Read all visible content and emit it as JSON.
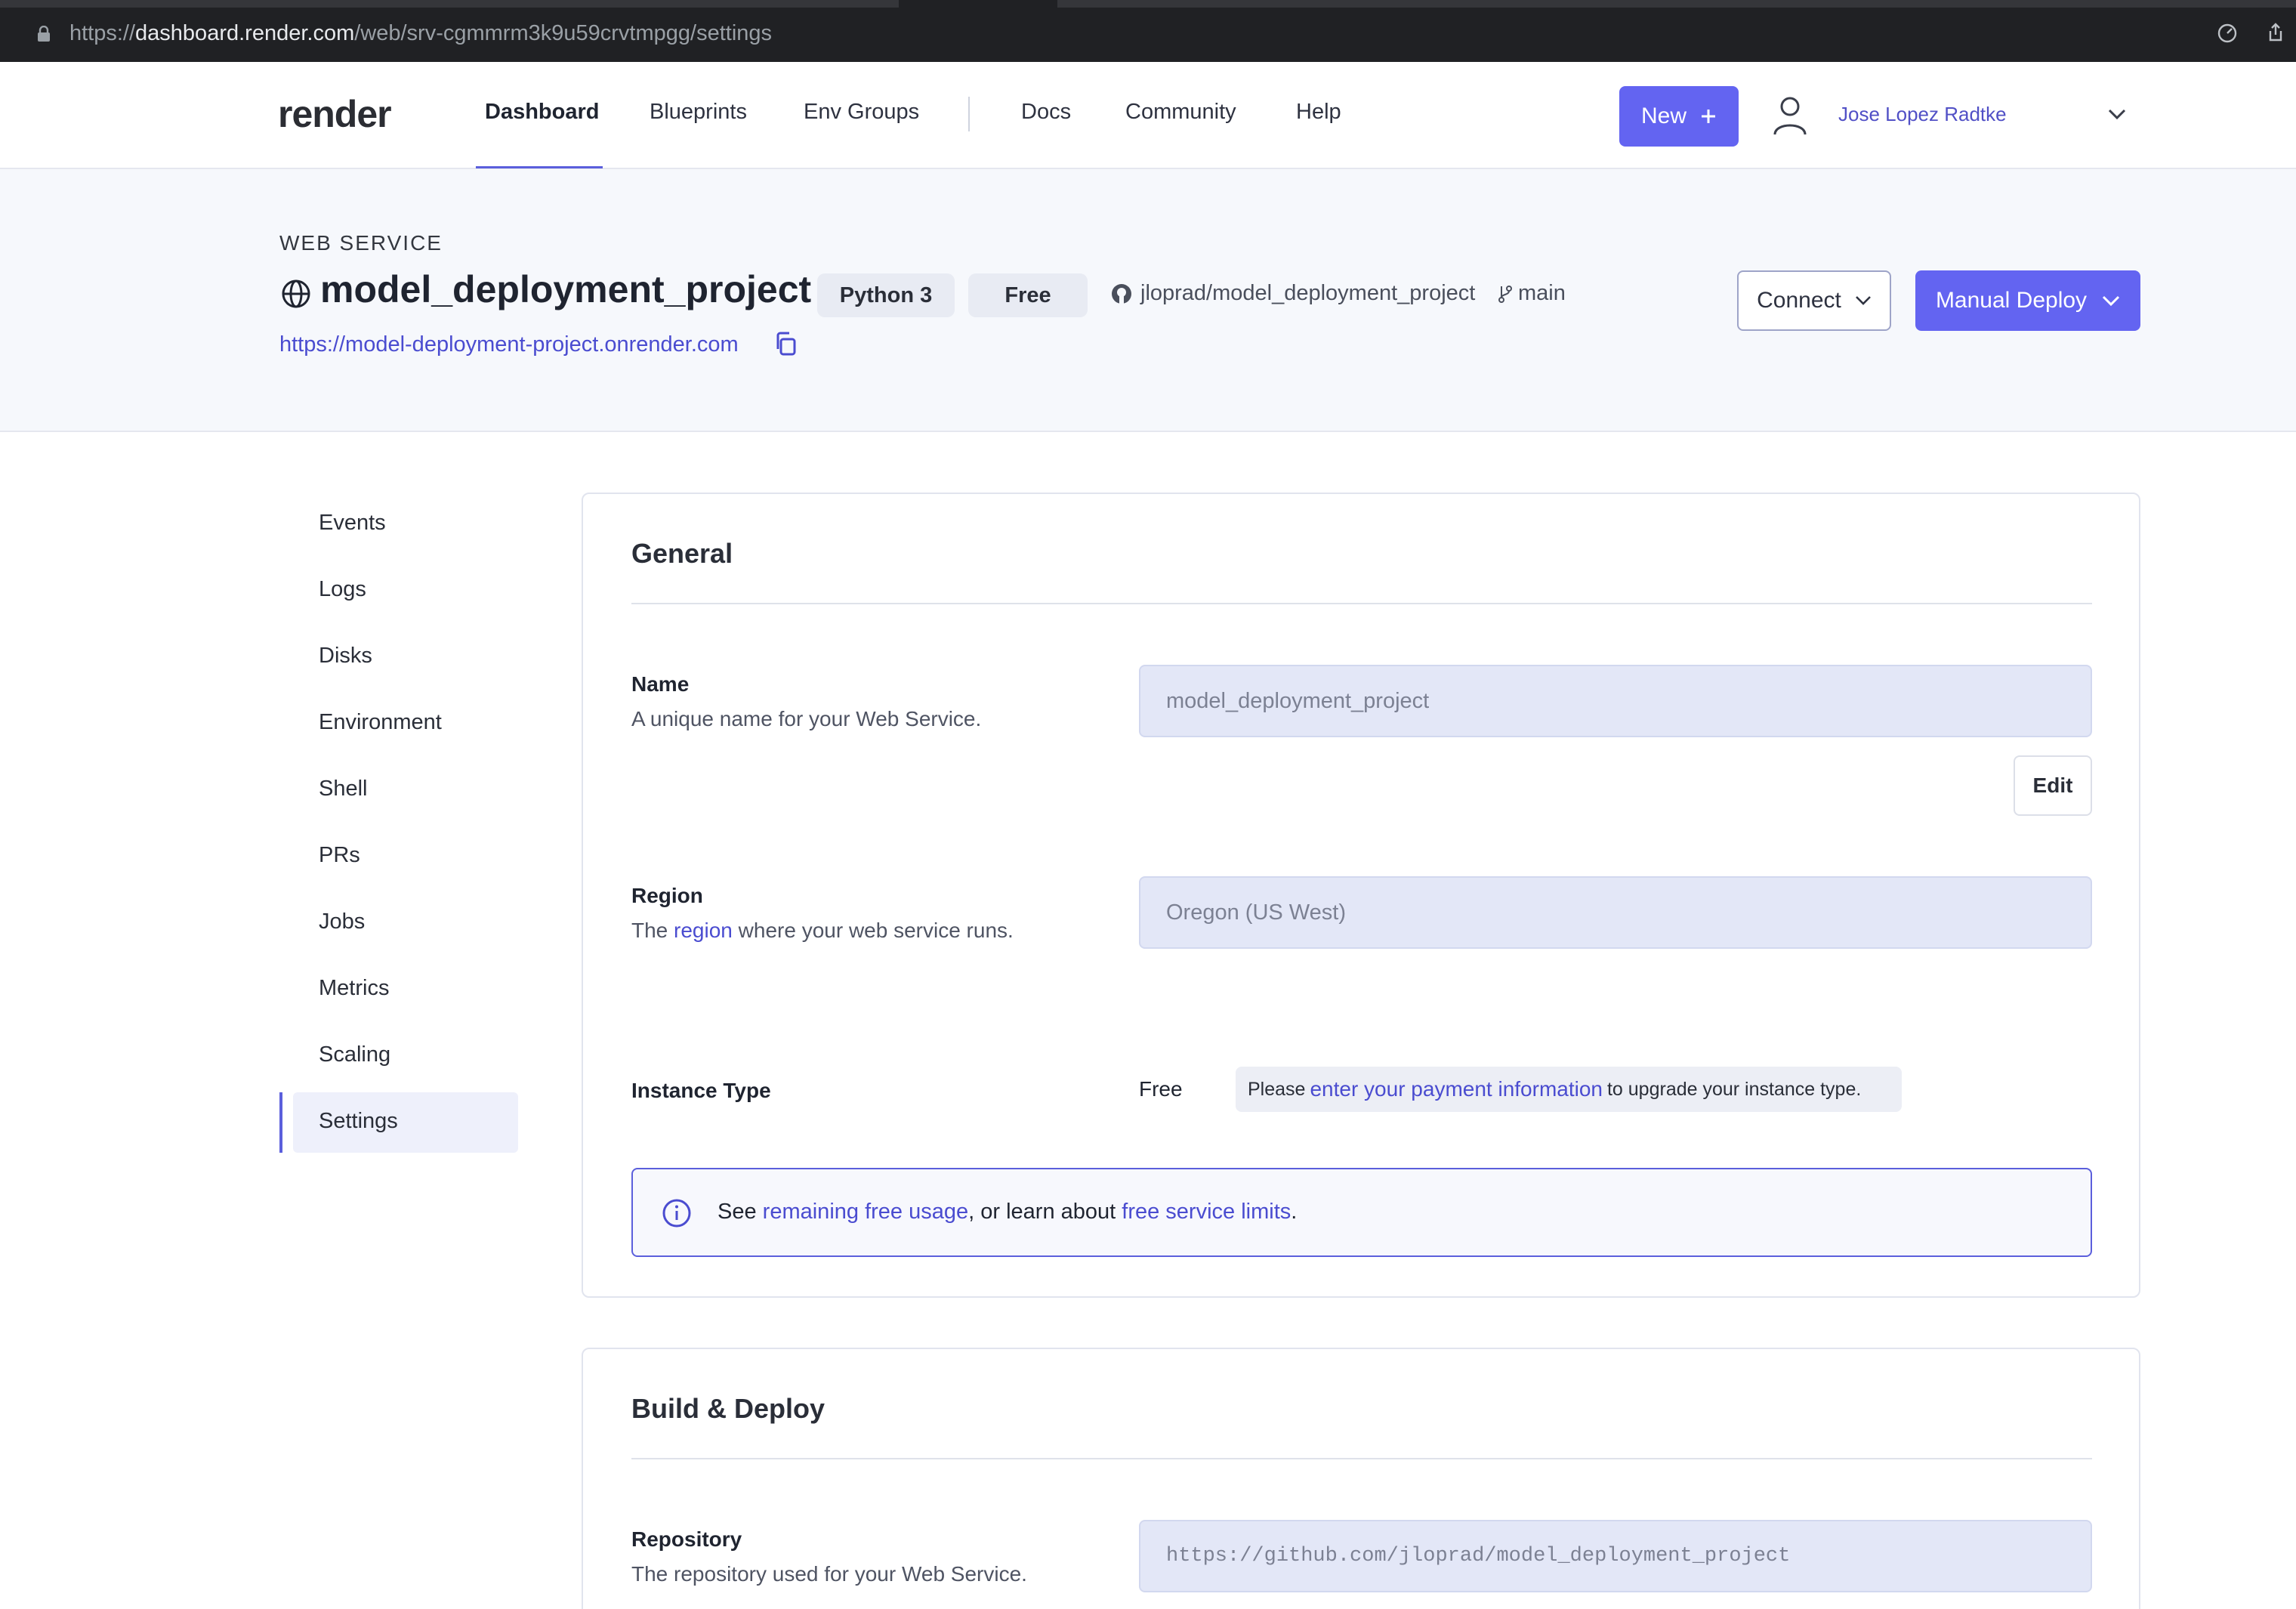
{
  "browser": {
    "url_prefix": "https://",
    "url_host": "dashboard.render.com",
    "url_path": "/web/srv-cgmmrm3k9u59crvtmpgg/settings"
  },
  "nav": {
    "logo": "render",
    "links": [
      "Dashboard",
      "Blueprints",
      "Env Groups",
      "Docs",
      "Community",
      "Help"
    ],
    "new_button": "New",
    "user_name": "Jose Lopez Radtke"
  },
  "service": {
    "type_label": "WEB SERVICE",
    "name": "model_deployment_project",
    "runtime_badge": "Python 3",
    "plan_badge": "Free",
    "repo": "jloprad/model_deployment_project",
    "branch": "main",
    "url": "https://model-deployment-project.onrender.com",
    "connect_button": "Connect",
    "deploy_button": "Manual Deploy"
  },
  "sidebar": {
    "items": [
      "Events",
      "Logs",
      "Disks",
      "Environment",
      "Shell",
      "PRs",
      "Jobs",
      "Metrics",
      "Scaling",
      "Settings"
    ],
    "active": "Settings"
  },
  "general": {
    "title": "General",
    "name_label": "Name",
    "name_desc": "A unique name for your Web Service.",
    "name_value": "model_deployment_project",
    "edit_button": "Edit",
    "region_label": "Region",
    "region_desc_prefix": "The",
    "region_desc_link": "region",
    "region_desc_suffix": "where your web service runs.",
    "region_value": "Oregon (US West)",
    "instance_label": "Instance Type",
    "instance_value": "Free",
    "instance_note_prefix": "Please",
    "instance_note_link": "enter your payment information",
    "instance_note_suffix": "to upgrade your instance type.",
    "info_prefix": "See",
    "info_link1": "remaining free usage",
    "info_mid": ", or learn about",
    "info_link2": "free service limits",
    "info_suffix": "."
  },
  "build": {
    "title": "Build & Deploy",
    "repo_label": "Repository",
    "repo_desc": "The repository used for your Web Service.",
    "repo_value": "https://github.com/jloprad/model_deployment_project"
  },
  "colors": {
    "accent": "#6364f1",
    "link": "#4a4cd0",
    "header_bg": "#f6f8fc",
    "input_bg": "#e3e7f7"
  }
}
